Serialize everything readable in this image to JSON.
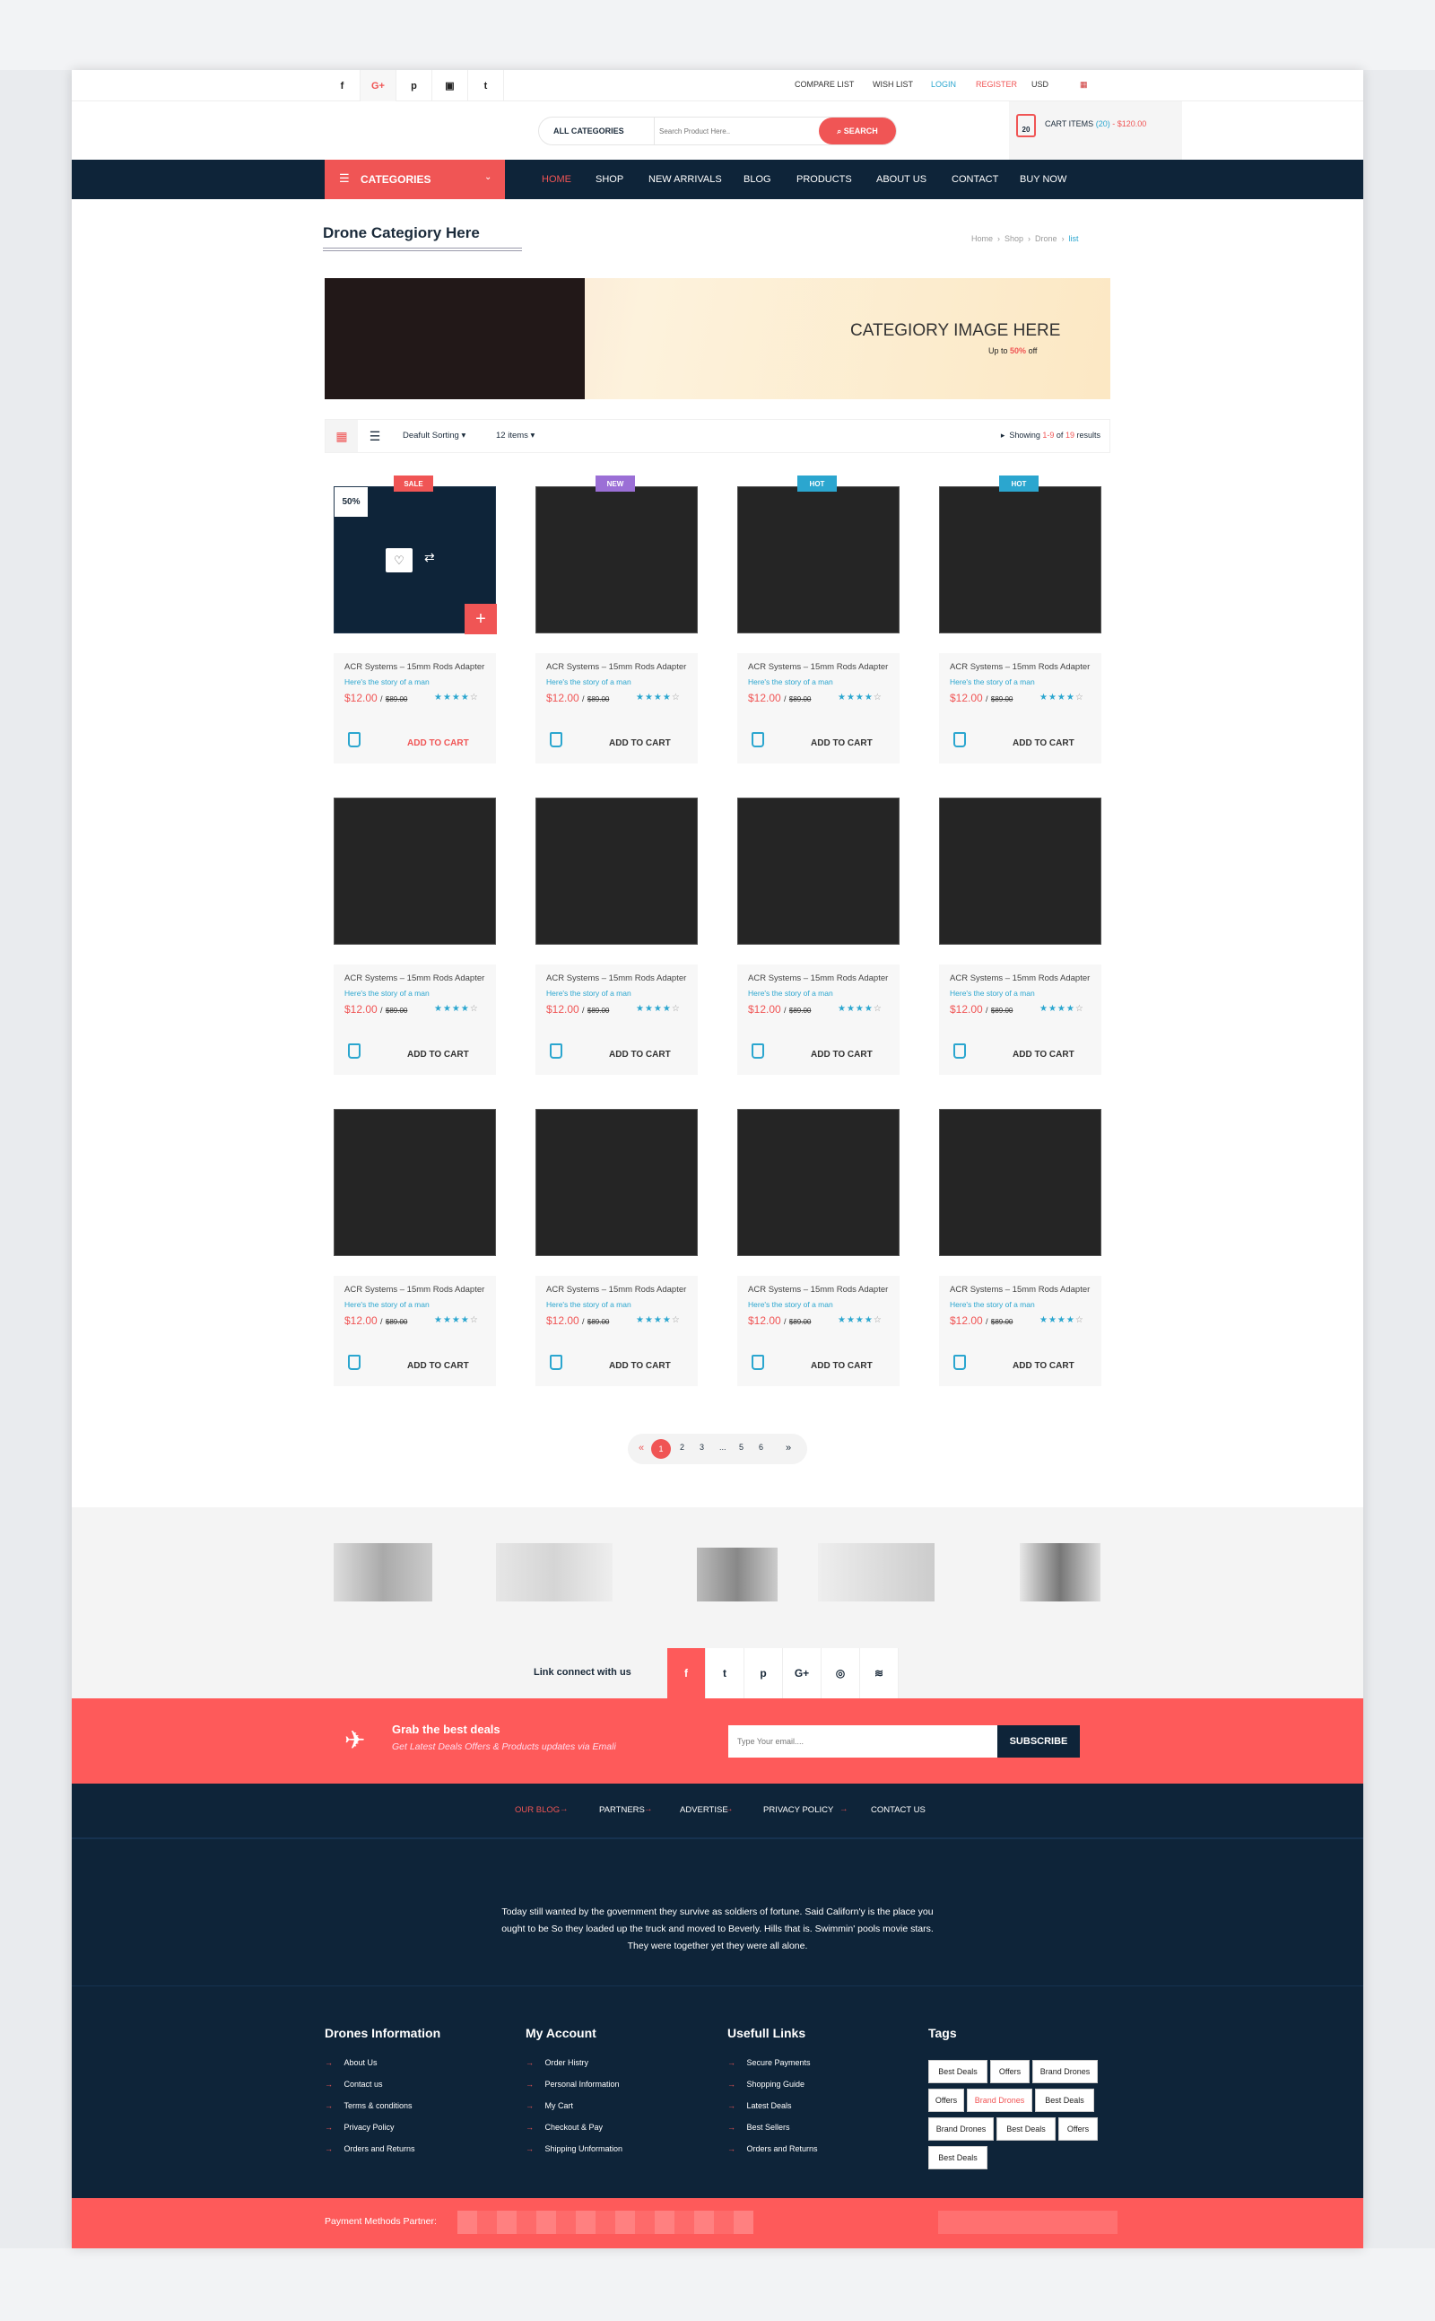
{
  "topbar": {
    "social": [
      "f",
      "G+",
      "p",
      "▣",
      "t"
    ],
    "links": {
      "compare": "COMPARE LIST",
      "wish": "WISH LIST",
      "login": "LOGIN",
      "register": "REGISTER",
      "currency": "USD"
    }
  },
  "header": {
    "category_select": "ALL CATEGORIES",
    "search_placeholder": "Search Product Here..",
    "search_button": "SEARCH",
    "cart_count": "20",
    "cart_label": "CART ITEMS",
    "cart_items": "(20)",
    "cart_total": "- $120.00"
  },
  "nav": {
    "categories": "CATEGORIES",
    "items": [
      "HOME",
      "SHOP",
      "NEW ARRIVALS",
      "BLOG",
      "PRODUCTS",
      "ABOUT US",
      "CONTACT",
      "BUY NOW"
    ]
  },
  "page": {
    "title": "Drone Categiory Here",
    "breadcrumb": [
      "Home",
      "Shop",
      "Drone",
      "list"
    ]
  },
  "banner": {
    "title": "CATEGIORY IMAGE HERE",
    "sub_pre": "Up to",
    "sub_pct": "50%",
    "sub_post": "off"
  },
  "toolbar": {
    "sorting": "Deafult Sorting",
    "per_page": "12 items",
    "showing_pre": "Showing",
    "range": "1-9",
    "of": "of",
    "total": "19",
    "results": "results"
  },
  "products": [
    {
      "badge": "SALE",
      "badge_color": "#f05555",
      "discount": "50%",
      "name": "ACR Systems – 15mm Rods Adapter",
      "story": "Here's the story of a man",
      "price": "$12.00",
      "old_price": "$89.00",
      "rating": 4,
      "add": "ADD TO CART",
      "hover": true
    },
    {
      "badge": "NEW",
      "badge_color": "#9b6fd6",
      "name": "ACR Systems – 15mm Rods Adapter",
      "story": "Here's the story of a man",
      "price": "$12.00",
      "old_price": "$89.00",
      "rating": 4,
      "add": "ADD TO CART"
    },
    {
      "badge": "HOT",
      "badge_color": "#2ba6cf",
      "name": "ACR Systems – 15mm Rods Adapter",
      "story": "Here's the story of a man",
      "price": "$12.00",
      "old_price": "$89.00",
      "rating": 4,
      "add": "ADD TO CART"
    },
    {
      "badge": "HOT",
      "badge_color": "#2ba6cf",
      "name": "ACR Systems – 15mm Rods Adapter",
      "story": "Here's the story of a man",
      "price": "$12.00",
      "old_price": "$89.00",
      "rating": 4,
      "add": "ADD TO CART"
    },
    {
      "name": "ACR Systems – 15mm Rods Adapter",
      "story": "Here's the story of a man",
      "price": "$12.00",
      "old_price": "$89.00",
      "rating": 4,
      "add": "ADD TO CART"
    },
    {
      "name": "ACR Systems – 15mm Rods Adapter",
      "story": "Here's the story of a man",
      "price": "$12.00",
      "old_price": "$89.00",
      "rating": 4,
      "add": "ADD TO CART"
    },
    {
      "name": "ACR Systems – 15mm Rods Adapter",
      "story": "Here's the story of a man",
      "price": "$12.00",
      "old_price": "$89.00",
      "rating": 4,
      "add": "ADD TO CART"
    },
    {
      "name": "ACR Systems – 15mm Rods Adapter",
      "story": "Here's the story of a man",
      "price": "$12.00",
      "old_price": "$89.00",
      "rating": 4,
      "add": "ADD TO CART"
    },
    {
      "name": "ACR Systems – 15mm Rods Adapter",
      "story": "Here's the story of a man",
      "price": "$12.00",
      "old_price": "$89.00",
      "rating": 4,
      "add": "ADD TO CART"
    },
    {
      "name": "ACR Systems – 15mm Rods Adapter",
      "story": "Here's the story of a man",
      "price": "$12.00",
      "old_price": "$89.00",
      "rating": 4,
      "add": "ADD TO CART"
    },
    {
      "name": "ACR Systems – 15mm Rods Adapter",
      "story": "Here's the story of a man",
      "price": "$12.00",
      "old_price": "$89.00",
      "rating": 4,
      "add": "ADD TO CART"
    },
    {
      "name": "ACR Systems – 15mm Rods Adapter",
      "story": "Here's the story of a man",
      "price": "$12.00",
      "old_price": "$89.00",
      "rating": 4,
      "add": "ADD TO CART"
    }
  ],
  "pagination": {
    "prev": "«",
    "pages": [
      "1",
      "2",
      "3",
      "...",
      "5",
      "6"
    ],
    "current": "1",
    "next": "»"
  },
  "social_connect": {
    "label": "Link connect with us",
    "icons": [
      "f",
      "t",
      "p",
      "G+",
      "◎",
      "≋"
    ]
  },
  "newsletter": {
    "title": "Grab the best deals",
    "subtitle": "Get Latest Deals Offers & Products updates via Emali",
    "placeholder": "Type Your email....",
    "button": "SUBSCRIBE"
  },
  "footer": {
    "links": [
      "OUR BLOG",
      "PARTNERS",
      "ADVERTISE",
      "PRIVACY  POLICY",
      "CONTACT US"
    ],
    "paragraph": [
      "Today still wanted by the government they survive as soldiers of fortune. Said Californ'y is the place you",
      "ought to be So they loaded up the truck and moved to Beverly. Hills that is. Swimmin' pools movie stars.",
      "They were together yet they were all alone."
    ],
    "columns": [
      {
        "title": "Drones  Information",
        "items": [
          "About Us",
          "Contact us",
          "Terms & conditions",
          "Privacy Policy",
          "Orders and Returns"
        ]
      },
      {
        "title": "My Account",
        "items": [
          "Order Histry",
          "Personal Information",
          "My Cart",
          "Checkout & Pay",
          "Shipping Unformation"
        ]
      },
      {
        "title": "Usefull Links",
        "items": [
          "Secure Payments",
          "Shopping Guide",
          "Latest Deals",
          "Best Sellers",
          "Orders and Returns"
        ]
      }
    ],
    "tags_title": "Tags",
    "tags": [
      "Best Deals",
      "Offers",
      "Brand Drones",
      "Offers",
      "Brand Drones",
      "Best Deals",
      "Brand Drones",
      "Best Deals",
      "Offers",
      "Best Deals"
    ],
    "payment_label": "Payment Methods Partner:"
  },
  "colors": {
    "accent": "#f05555",
    "navy": "#0e2439",
    "blue": "#2ba6cf"
  }
}
